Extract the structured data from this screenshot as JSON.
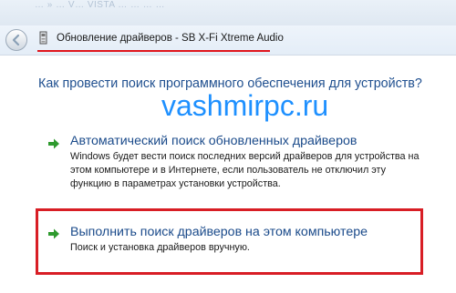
{
  "top_strip": {
    "text": "… »  …  V… VISTA … … … …"
  },
  "window": {
    "title": "Обновление драйверов - SB X-Fi Xtreme Audio",
    "back_icon": "back-arrow-icon",
    "device_icon": "audio-device-icon"
  },
  "main": {
    "question": "Как провести поиск программного обеспечения для устройств?",
    "watermark": "vashmirpc.ru",
    "options": [
      {
        "title": "Автоматический поиск обновленных драйверов",
        "description": [
          "Windows будет вести поиск последних версий драйверов для устройства на",
          "этом компьютере и в Интернете, если пользователь не отключил эту",
          "функцию в параметрах установки устройства."
        ],
        "icon": "green-arrow-icon"
      },
      {
        "title": "Выполнить поиск драйверов на этом компьютере",
        "description": [
          "Поиск и установка драйверов вручную."
        ],
        "icon": "green-arrow-icon",
        "highlight_color": "#d81e25"
      }
    ]
  },
  "colors": {
    "heading_blue": "#1f4f8f",
    "link_blue": "#1a4a8a",
    "watermark_blue": "#1e90ff",
    "highlight_red": "#e0151c",
    "arrow_green": "#2e9a2e"
  }
}
